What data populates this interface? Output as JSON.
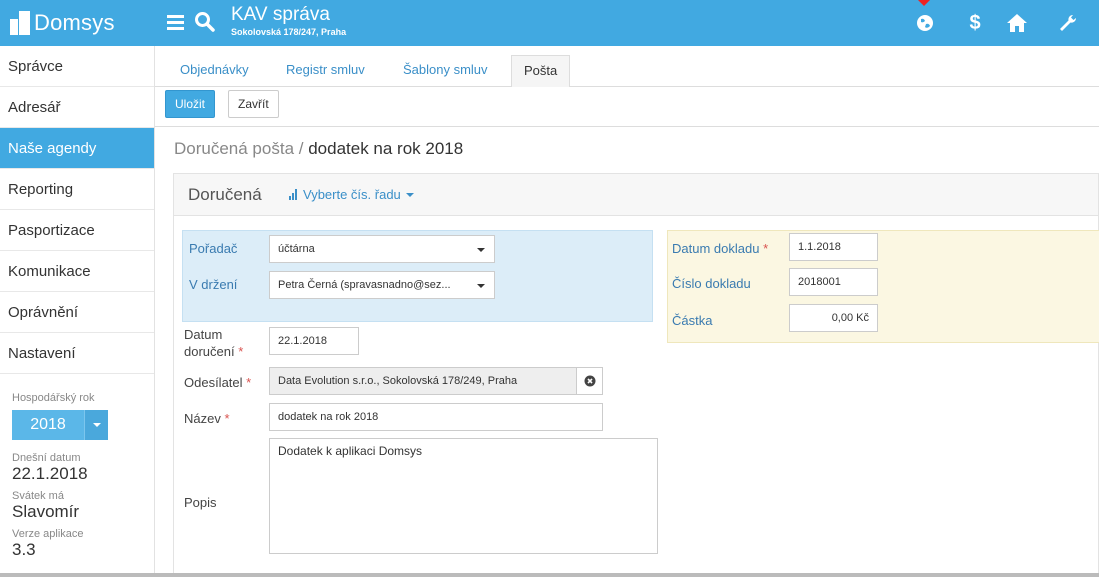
{
  "topbar": {
    "logo_text": "Domsys",
    "title": "KAV správa",
    "subtitle": "Sokolovská 178/247, Praha",
    "icons": [
      "menu-icon",
      "search-icon",
      "globe-icon",
      "dollar-icon",
      "home-icon",
      "wrench-icon"
    ],
    "accent_color": "#41a9e1"
  },
  "sidebar": {
    "items": [
      {
        "label": "Správce"
      },
      {
        "label": "Adresář"
      },
      {
        "label": "Naše agendy"
      },
      {
        "label": "Reporting"
      },
      {
        "label": "Pasportizace"
      },
      {
        "label": "Komunikace"
      },
      {
        "label": "Oprávnění"
      },
      {
        "label": "Nastavení"
      }
    ],
    "active_index": 2,
    "fiscal_year_label": "Hospodářský rok",
    "fiscal_year_value": "2018",
    "today_label": "Dnešní datum",
    "today_value": "22.1.2018",
    "nameday_label": "Svátek má",
    "nameday_value": "Slavomír",
    "version_label": "Verze aplikace",
    "version_value": "3.3"
  },
  "tabs": [
    {
      "label": "Objednávky"
    },
    {
      "label": "Registr smluv"
    },
    {
      "label": "Šablony smluv"
    },
    {
      "label": "Pošta"
    }
  ],
  "toolbar": {
    "save_label": "Uložit",
    "close_label": "Zavřít"
  },
  "breadcrumb": {
    "parent": "Doručená pošta /",
    "current": "dodatek na rok 2018"
  },
  "panel": {
    "title": "Doručená",
    "series_label": "Vyberte čís. řadu"
  },
  "form": {
    "poradac_label": "Pořadač",
    "poradac_value": "účtárna",
    "drzeni_label": "V držení",
    "drzeni_value": "Petra Černá (spravasnadno@sez...",
    "datum_doruceni_label_1": "Datum",
    "datum_doruceni_label_2": "doručení",
    "datum_doruceni_value": "22.1.2018",
    "odesilatel_label": "Odesílatel",
    "odesilatel_value": "Data Evolution s.r.o., Sokolovská 178/249, Praha",
    "nazev_label": "Název",
    "nazev_value": "dodatek na rok 2018",
    "popis_label": "Popis",
    "popis_value": "Dodatek k aplikaci Domsys",
    "datum_dokladu_label": "Datum dokladu",
    "datum_dokladu_value": "1.1.2018",
    "cislo_dokladu_label": "Číslo dokladu",
    "cislo_dokladu_value": "2018001",
    "castka_label": "Částka",
    "castka_value": "0,00 Kč",
    "required_mark": "*"
  }
}
